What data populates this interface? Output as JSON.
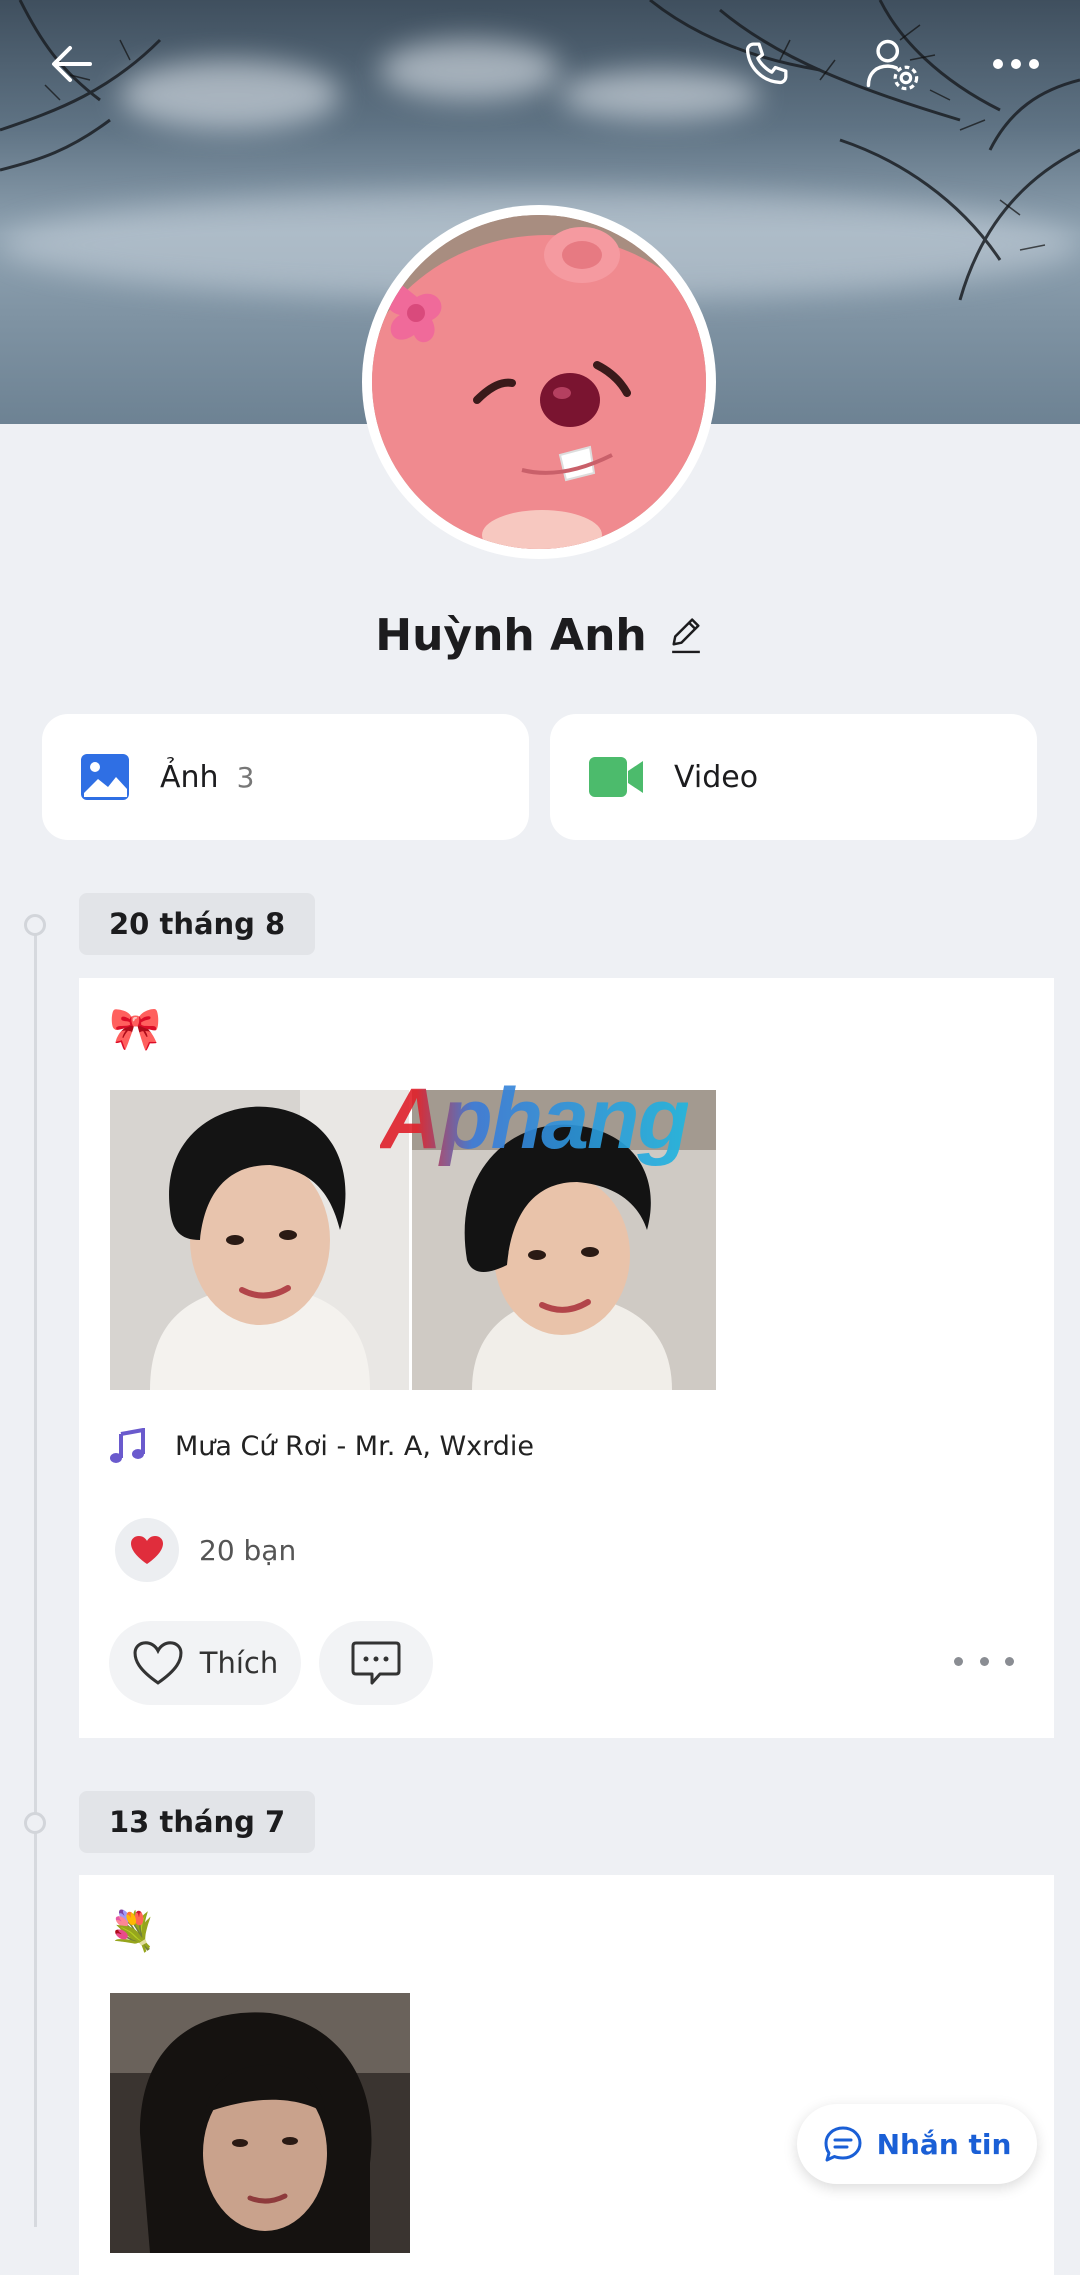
{
  "profile": {
    "name": "Huỳnh Anh"
  },
  "media": {
    "photos_label": "Ảnh",
    "photos_count": "3",
    "video_label": "Video"
  },
  "posts": [
    {
      "date": "20 tháng 8",
      "emoji": "🎀",
      "music": "Mưa Cứ Rơi - Mr. A, Wxrdie",
      "reactions": "20 bạn",
      "like_label": "Thích"
    },
    {
      "date": "13 tháng 7",
      "emoji": "💐"
    }
  ],
  "watermark": "Aphang",
  "fab": {
    "label": "Nhắn tin"
  },
  "colors": {
    "accent_blue": "#1a5fd6",
    "photo_icon": "#2f6fe4",
    "video_icon": "#4cbb6c",
    "music_icon": "#6a5acd",
    "background": "#eef0f4"
  },
  "icons": {
    "back": "arrow-left-icon",
    "call": "phone-icon",
    "settings": "user-settings-icon",
    "more": "more-horizontal-icon"
  }
}
